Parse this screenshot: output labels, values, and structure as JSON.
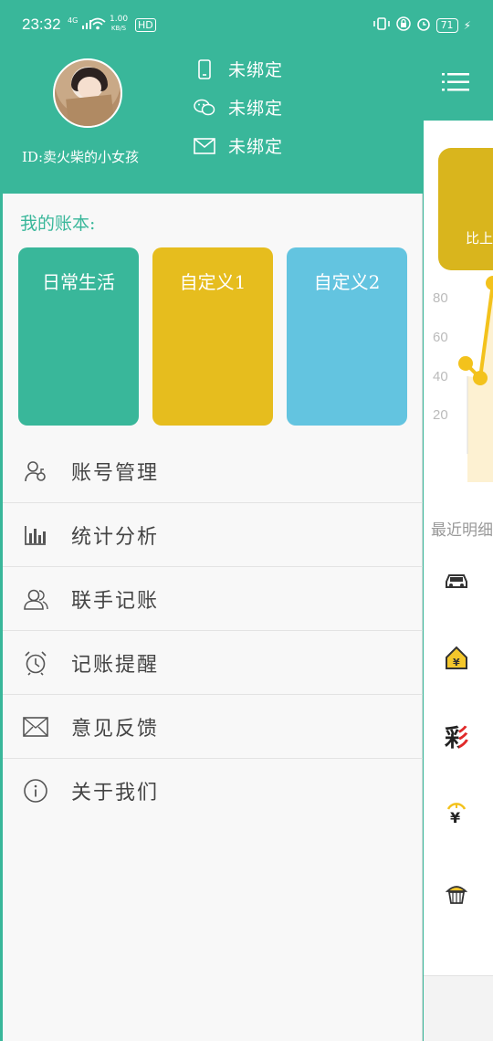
{
  "status_bar": {
    "time": "23:32",
    "network": "4G",
    "speed_value": "1.00",
    "speed_unit": "KB/S",
    "hd": "HD",
    "battery": "71"
  },
  "profile": {
    "user_id": "ID:卖火柴的小女孩",
    "bindings": [
      {
        "icon": "phone-icon",
        "label": "未绑定"
      },
      {
        "icon": "wechat-icon",
        "label": "未绑定"
      },
      {
        "icon": "mail-icon",
        "label": "未绑定"
      }
    ]
  },
  "drawer": {
    "books_title": "我的账本:",
    "books": [
      {
        "label": "日常生活",
        "color": "#39b79a"
      },
      {
        "label": "自定义1",
        "color": "#e6bd1e"
      },
      {
        "label": "自定义2",
        "color": "#63c4e0"
      }
    ],
    "menu": [
      {
        "icon": "account-manage-icon",
        "label": "账号管理"
      },
      {
        "icon": "bar-chart-icon",
        "label": "统计分析"
      },
      {
        "icon": "users-icon",
        "label": "联手记账"
      },
      {
        "icon": "alarm-clock-icon",
        "label": "记账提醒"
      },
      {
        "icon": "mail-icon",
        "label": "意见反馈"
      },
      {
        "icon": "info-icon",
        "label": "关于我们"
      }
    ]
  },
  "background_page": {
    "card_text": "比上",
    "axis_ticks": [
      "80",
      "60",
      "40",
      "20"
    ],
    "section_title": "最近明细",
    "row_icons": [
      "car-icon",
      "house-icon",
      "lottery-icon",
      "money-icon",
      "cake-icon"
    ],
    "lottery_char": "彩",
    "money_char": "¥",
    "colors": {
      "accent": "#39b79a",
      "card": "#d9b51d",
      "line": "#f3c21c"
    }
  }
}
